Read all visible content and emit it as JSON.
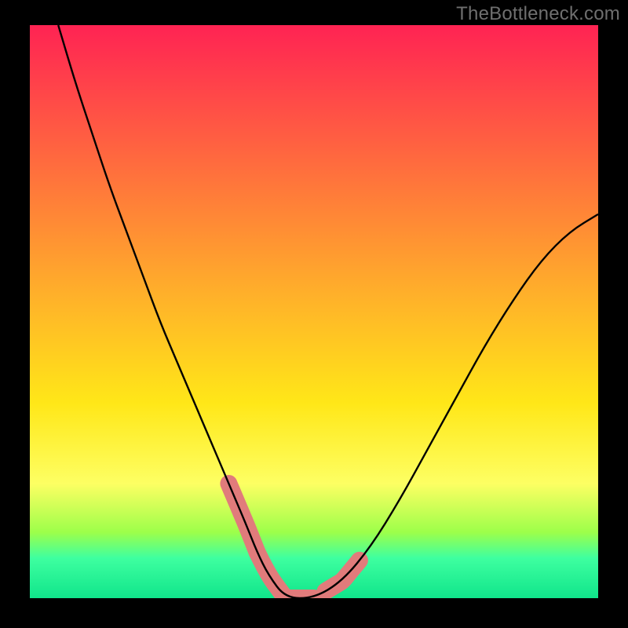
{
  "watermark": "TheBottleneck.com",
  "colors": {
    "background": "#000000",
    "curve": "#000000",
    "marker": "#e17b7b",
    "grad_top": "#ff2353",
    "grad_mid": "#ffd21f",
    "grad_green1": "#7fff5a",
    "grad_green2": "#2eff9a",
    "grad_bottom": "#00d680"
  },
  "chart_data": {
    "type": "line",
    "title": "",
    "xlabel": "",
    "ylabel": "",
    "xlim": [
      0,
      100
    ],
    "ylim": [
      0,
      100
    ],
    "series": [
      {
        "name": "bottleneck-curve",
        "x": [
          5,
          8,
          11,
          14,
          17,
          20,
          23,
          26,
          29,
          32,
          35,
          38,
          40,
          42,
          45,
          50,
          55,
          60,
          65,
          70,
          75,
          80,
          85,
          90,
          95,
          100
        ],
        "y": [
          100,
          90,
          81,
          72,
          64,
          56,
          48,
          41,
          34,
          27,
          20,
          13,
          8,
          4,
          0,
          0,
          3,
          9,
          17,
          26,
          35,
          44,
          52,
          59,
          64,
          67
        ]
      }
    ],
    "highlight_zones": [
      {
        "name": "left-descent-marker",
        "x_range": [
          35,
          40
        ],
        "y_range": [
          7,
          20
        ]
      },
      {
        "name": "valley-floor-marker",
        "x_range": [
          40,
          50
        ],
        "y_range": [
          0,
          4
        ]
      },
      {
        "name": "right-ascent-marker",
        "x_range": [
          52,
          58
        ],
        "y_range": [
          3,
          10
        ]
      }
    ],
    "gradient_bands": {
      "orientation": "vertical",
      "stops": [
        {
          "pos": 0.0,
          "color": "#ff2353"
        },
        {
          "pos": 0.47,
          "color": "#ffb02a"
        },
        {
          "pos": 0.66,
          "color": "#ffe718"
        },
        {
          "pos": 0.8,
          "color": "#fdff63"
        },
        {
          "pos": 0.885,
          "color": "#9dff4a"
        },
        {
          "pos": 0.93,
          "color": "#3effa0"
        },
        {
          "pos": 1.0,
          "color": "#10e58b"
        }
      ]
    }
  }
}
